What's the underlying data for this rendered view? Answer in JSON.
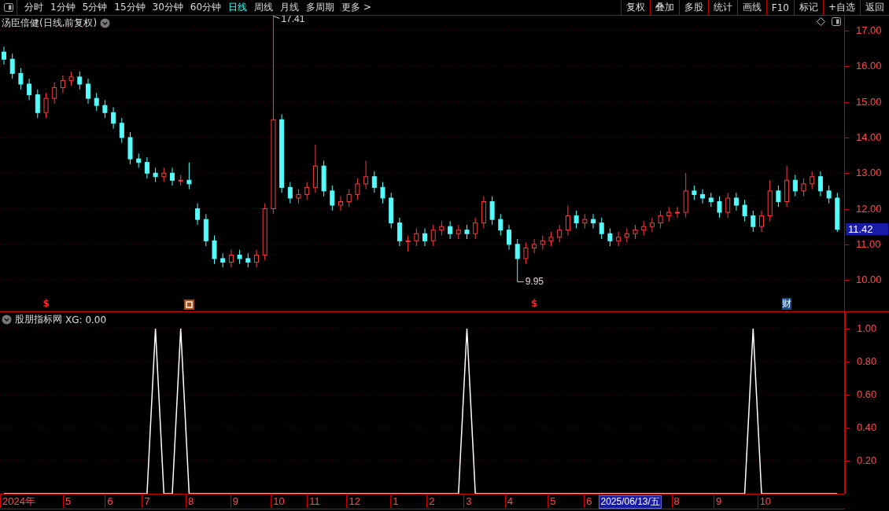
{
  "toolbar": {
    "tabs": [
      {
        "label": "分时",
        "selected": false
      },
      {
        "label": "1分钟",
        "selected": false
      },
      {
        "label": "5分钟",
        "selected": false
      },
      {
        "label": "15分钟",
        "selected": false
      },
      {
        "label": "30分钟",
        "selected": false
      },
      {
        "label": "60分钟",
        "selected": false
      },
      {
        "label": "日线",
        "selected": true
      },
      {
        "label": "周线",
        "selected": false
      },
      {
        "label": "月线",
        "selected": false
      },
      {
        "label": "多周期",
        "selected": false
      },
      {
        "label": "更多 >",
        "selected": false
      }
    ],
    "buttons": [
      "复权",
      "叠加",
      "多股",
      "统计",
      "画线",
      "F10",
      "标记",
      "+自选",
      "返回"
    ]
  },
  "price_panel": {
    "title": "汤臣倍健(日线,前复权)",
    "last_price": "11.42",
    "chart_data": {
      "type": "candlestick",
      "ylim": [
        9.12,
        17.42
      ],
      "yticks": [
        {
          "value": 17,
          "label": "17.00"
        },
        {
          "value": 16,
          "label": "16.00"
        },
        {
          "value": 15,
          "label": "15.00"
        },
        {
          "value": 14,
          "label": "14.00"
        },
        {
          "value": 13,
          "label": "13.00"
        },
        {
          "value": 12,
          "label": "12.00"
        },
        {
          "value": 11,
          "label": "11.00"
        },
        {
          "value": 10,
          "label": "10.00"
        }
      ],
      "ohlc": [
        [
          16.4,
          16.55,
          16.05,
          16.2
        ],
        [
          16.2,
          16.35,
          15.65,
          15.8
        ],
        [
          15.8,
          15.95,
          15.35,
          15.5
        ],
        [
          15.5,
          15.65,
          15.05,
          15.2
        ],
        [
          15.2,
          15.35,
          14.55,
          14.7
        ],
        [
          14.7,
          15.25,
          14.55,
          15.1
        ],
        [
          15.1,
          15.55,
          14.95,
          15.4
        ],
        [
          15.4,
          15.75,
          15.25,
          15.6
        ],
        [
          15.6,
          15.85,
          15.45,
          15.7
        ],
        [
          15.7,
          15.85,
          15.35,
          15.5
        ],
        [
          15.5,
          15.65,
          14.95,
          15.1
        ],
        [
          15.1,
          15.25,
          14.75,
          14.9
        ],
        [
          14.9,
          15.05,
          14.55,
          14.7
        ],
        [
          14.7,
          14.85,
          14.25,
          14.4
        ],
        [
          14.4,
          14.55,
          13.85,
          14.0
        ],
        [
          14.0,
          14.15,
          13.25,
          13.4
        ],
        [
          13.4,
          13.55,
          13.15,
          13.3
        ],
        [
          13.3,
          13.45,
          12.85,
          13.0
        ],
        [
          13.0,
          13.15,
          12.75,
          12.9
        ],
        [
          12.9,
          13.15,
          12.75,
          13.0
        ],
        [
          13.0,
          13.15,
          12.65,
          12.8
        ],
        [
          12.8,
          12.95,
          12.65,
          12.8
        ],
        [
          12.8,
          13.3,
          12.55,
          12.7
        ],
        [
          12.0,
          12.15,
          11.55,
          11.7
        ],
        [
          11.7,
          11.85,
          10.95,
          11.1
        ],
        [
          11.1,
          11.25,
          10.45,
          10.6
        ],
        [
          10.6,
          10.75,
          10.35,
          10.5
        ],
        [
          10.5,
          10.85,
          10.35,
          10.7
        ],
        [
          10.7,
          10.85,
          10.45,
          10.6
        ],
        [
          10.6,
          10.75,
          10.35,
          10.5
        ],
        [
          10.5,
          10.85,
          10.35,
          10.7
        ],
        [
          10.7,
          12.15,
          10.55,
          12.0
        ],
        [
          12.0,
          17.41,
          11.85,
          14.5
        ],
        [
          14.5,
          14.65,
          12.45,
          12.6
        ],
        [
          12.6,
          12.75,
          12.15,
          12.3
        ],
        [
          12.3,
          12.55,
          12.15,
          12.4
        ],
        [
          12.4,
          12.75,
          12.25,
          12.6
        ],
        [
          12.6,
          13.8,
          12.45,
          13.2
        ],
        [
          13.2,
          13.35,
          12.35,
          12.5
        ],
        [
          12.5,
          12.65,
          11.95,
          12.1
        ],
        [
          12.1,
          12.35,
          11.95,
          12.2
        ],
        [
          12.2,
          12.55,
          12.05,
          12.4
        ],
        [
          12.4,
          12.85,
          12.25,
          12.7
        ],
        [
          12.7,
          13.35,
          12.55,
          12.9
        ],
        [
          12.9,
          13.05,
          12.45,
          12.6
        ],
        [
          12.6,
          12.75,
          12.15,
          12.3
        ],
        [
          12.3,
          12.45,
          11.45,
          11.6
        ],
        [
          11.6,
          11.75,
          10.95,
          11.1
        ],
        [
          11.1,
          11.25,
          10.8,
          11.1
        ],
        [
          11.1,
          11.45,
          10.95,
          11.3
        ],
        [
          11.3,
          11.45,
          10.95,
          11.1
        ],
        [
          11.1,
          11.55,
          10.95,
          11.4
        ],
        [
          11.4,
          11.65,
          11.25,
          11.5
        ],
        [
          11.5,
          11.65,
          11.15,
          11.3
        ],
        [
          11.3,
          11.55,
          11.15,
          11.4
        ],
        [
          11.4,
          11.55,
          11.15,
          11.3
        ],
        [
          11.3,
          11.75,
          11.15,
          11.6
        ],
        [
          11.6,
          12.35,
          11.45,
          12.2
        ],
        [
          12.2,
          12.35,
          11.55,
          11.7
        ],
        [
          11.7,
          11.85,
          11.25,
          11.4
        ],
        [
          11.4,
          11.55,
          10.85,
          11.0
        ],
        [
          11.0,
          11.15,
          9.95,
          10.6
        ],
        [
          10.6,
          11.05,
          10.45,
          10.9
        ],
        [
          10.9,
          11.15,
          10.75,
          11.0
        ],
        [
          11.0,
          11.25,
          10.85,
          11.1
        ],
        [
          11.1,
          11.35,
          10.95,
          11.2
        ],
        [
          11.2,
          11.55,
          11.05,
          11.4
        ],
        [
          11.4,
          12.1,
          11.25,
          11.8
        ],
        [
          11.8,
          11.95,
          11.45,
          11.6
        ],
        [
          11.6,
          11.85,
          11.45,
          11.7
        ],
        [
          11.7,
          11.85,
          11.45,
          11.6
        ],
        [
          11.6,
          11.75,
          11.15,
          11.3
        ],
        [
          11.3,
          11.45,
          10.95,
          11.1
        ],
        [
          11.1,
          11.35,
          10.95,
          11.2
        ],
        [
          11.2,
          11.45,
          11.05,
          11.3
        ],
        [
          11.3,
          11.55,
          11.15,
          11.4
        ],
        [
          11.4,
          11.65,
          11.25,
          11.5
        ],
        [
          11.5,
          11.75,
          11.35,
          11.6
        ],
        [
          11.6,
          11.95,
          11.45,
          11.8
        ],
        [
          11.8,
          12.05,
          11.65,
          11.9
        ],
        [
          11.9,
          12.05,
          11.75,
          11.9
        ],
        [
          11.9,
          13.0,
          11.75,
          12.5
        ],
        [
          12.5,
          12.65,
          12.25,
          12.4
        ],
        [
          12.4,
          12.55,
          12.15,
          12.3
        ],
        [
          12.3,
          12.45,
          12.05,
          12.2
        ],
        [
          12.2,
          12.35,
          11.75,
          11.9
        ],
        [
          11.9,
          12.45,
          11.75,
          12.3
        ],
        [
          12.3,
          12.45,
          11.95,
          12.1
        ],
        [
          12.1,
          12.25,
          11.65,
          11.8
        ],
        [
          11.8,
          11.95,
          11.35,
          11.5
        ],
        [
          11.5,
          11.95,
          11.35,
          11.8
        ],
        [
          11.8,
          12.8,
          11.65,
          12.5
        ],
        [
          12.5,
          12.65,
          12.05,
          12.2
        ],
        [
          12.2,
          13.2,
          12.05,
          12.8
        ],
        [
          12.8,
          12.95,
          12.35,
          12.5
        ],
        [
          12.5,
          12.85,
          12.35,
          12.7
        ],
        [
          12.7,
          13.05,
          12.55,
          12.9
        ],
        [
          12.9,
          13.05,
          12.35,
          12.5
        ],
        [
          12.5,
          12.65,
          12.15,
          12.3
        ],
        [
          12.3,
          12.45,
          11.35,
          11.42
        ]
      ],
      "annotations": [
        "17.41",
        "9.95"
      ],
      "grid": true
    },
    "events": [
      {
        "kind": "dollar",
        "text": "$"
      },
      {
        "kind": "box"
      },
      {
        "kind": "dollar",
        "text": "$"
      },
      {
        "kind": "finance",
        "text": "财"
      }
    ]
  },
  "indicator_panel": {
    "title": "股朋指标网",
    "reading": "XG: 0.00",
    "chart_data": {
      "type": "line",
      "grid": true,
      "ylim": [
        0,
        1.1
      ],
      "yticks": [
        {
          "value": 1,
          "label": "1.00"
        },
        {
          "value": 0.8,
          "label": "0.80"
        },
        {
          "value": 0.6,
          "label": "0.60"
        },
        {
          "value": 0.4,
          "label": "0.40"
        },
        {
          "value": 0.2,
          "label": "0.20"
        }
      ],
      "values": [
        0,
        0,
        0,
        0,
        0,
        0,
        0,
        0,
        0,
        0,
        0,
        0,
        0,
        0,
        0,
        0,
        0,
        0,
        1,
        0,
        0,
        1,
        0,
        0,
        0,
        0,
        0,
        0,
        0,
        0,
        0,
        0,
        0,
        0,
        0,
        0,
        0,
        0,
        0,
        0,
        0,
        0,
        0,
        0,
        0,
        0,
        0,
        0,
        0,
        0,
        0,
        0,
        0,
        0,
        0,
        1,
        0,
        0,
        0,
        0,
        0,
        0,
        0,
        0,
        0,
        0,
        0,
        0,
        0,
        0,
        0,
        0,
        0,
        0,
        0,
        0,
        0,
        0,
        0,
        0,
        0,
        0,
        0,
        0,
        0,
        0,
        0,
        0,
        0,
        1,
        0,
        0,
        0,
        0,
        0,
        0,
        0,
        0,
        0,
        0
      ]
    }
  },
  "time_axis": [
    {
      "label": "2024年",
      "kind": "tick"
    },
    {
      "label": "5",
      "kind": "tick"
    },
    {
      "label": "6",
      "kind": "tick"
    },
    {
      "label": "7",
      "kind": "tick"
    },
    {
      "label": "8",
      "kind": "tick"
    },
    {
      "label": "9",
      "kind": "tick"
    },
    {
      "label": "10",
      "kind": "tick"
    },
    {
      "label": "11",
      "kind": "tick"
    },
    {
      "label": "12",
      "kind": "tick"
    },
    {
      "label": "1",
      "kind": "tick"
    },
    {
      "label": "2",
      "kind": "tick"
    },
    {
      "label": "3",
      "kind": "tick"
    },
    {
      "label": "4",
      "kind": "tick"
    },
    {
      "label": "5",
      "kind": "tick"
    },
    {
      "label": "6",
      "kind": "tick"
    },
    {
      "label": "2025/06/13/五",
      "kind": "cursor"
    },
    {
      "label": "8",
      "kind": "tick"
    },
    {
      "label": "9",
      "kind": "tick"
    },
    {
      "label": "10",
      "kind": "tick"
    }
  ]
}
